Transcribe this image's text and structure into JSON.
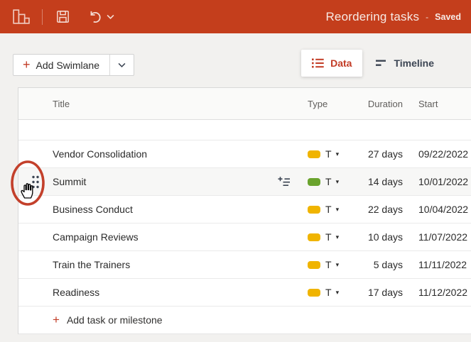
{
  "colors": {
    "header_bg": "#C43E1C",
    "accent": "#C23B25",
    "ink": "#3C4553",
    "type_yellow": "#F0B400",
    "type_green": "#6AA32D",
    "annotation_red": "#C3402B"
  },
  "header": {
    "title": "Reordering tasks",
    "separator": "-",
    "status": "Saved",
    "icons": {
      "app": "swimlane-chart-icon",
      "save": "save-icon",
      "undo": "undo-icon",
      "undo_dropdown": "chevron-down-icon"
    }
  },
  "toolbar": {
    "add_swimlane_label": "Add Swimlane",
    "dropdown_icon": "chevron-down-icon"
  },
  "view_tabs": [
    {
      "label": "Data",
      "icon": "list-icon",
      "active": true
    },
    {
      "label": "Timeline",
      "icon": "timeline-bars-icon",
      "active": false
    }
  ],
  "table": {
    "columns": {
      "title": "Title",
      "type": "Type",
      "duration": "Duration",
      "start": "Start"
    },
    "rows": [
      {
        "title": "Vendor Consolidation",
        "type_label": "T",
        "type_color": "#F0B400",
        "duration": "27 days",
        "start": "09/22/2022"
      },
      {
        "title": "Summit",
        "type_label": "T",
        "type_color": "#6AA32D",
        "duration": "14 days",
        "start": "10/01/2022",
        "highlighted": true,
        "drag_handle_visible": true,
        "subtask_icon_visible": true
      },
      {
        "title": "Business Conduct",
        "type_label": "T",
        "type_color": "#F0B400",
        "duration": "22 days",
        "start": "10/04/2022"
      },
      {
        "title": "Campaign Reviews",
        "type_label": "T",
        "type_color": "#F0B400",
        "duration": "10 days",
        "start": "11/07/2022"
      },
      {
        "title": "Train the Trainers",
        "type_label": "T",
        "type_color": "#F0B400",
        "duration": "5 days",
        "start": "11/11/2022"
      },
      {
        "title": "Readiness",
        "type_label": "T",
        "type_color": "#F0B400",
        "duration": "17 days",
        "start": "11/12/2022"
      }
    ],
    "add_row_label": "Add task or milestone"
  },
  "annotation": {
    "shape": "red-ellipse-callout",
    "highlights": "row-drag-handle",
    "cursor": "grab-hand-cursor",
    "color": "#C3402B"
  }
}
